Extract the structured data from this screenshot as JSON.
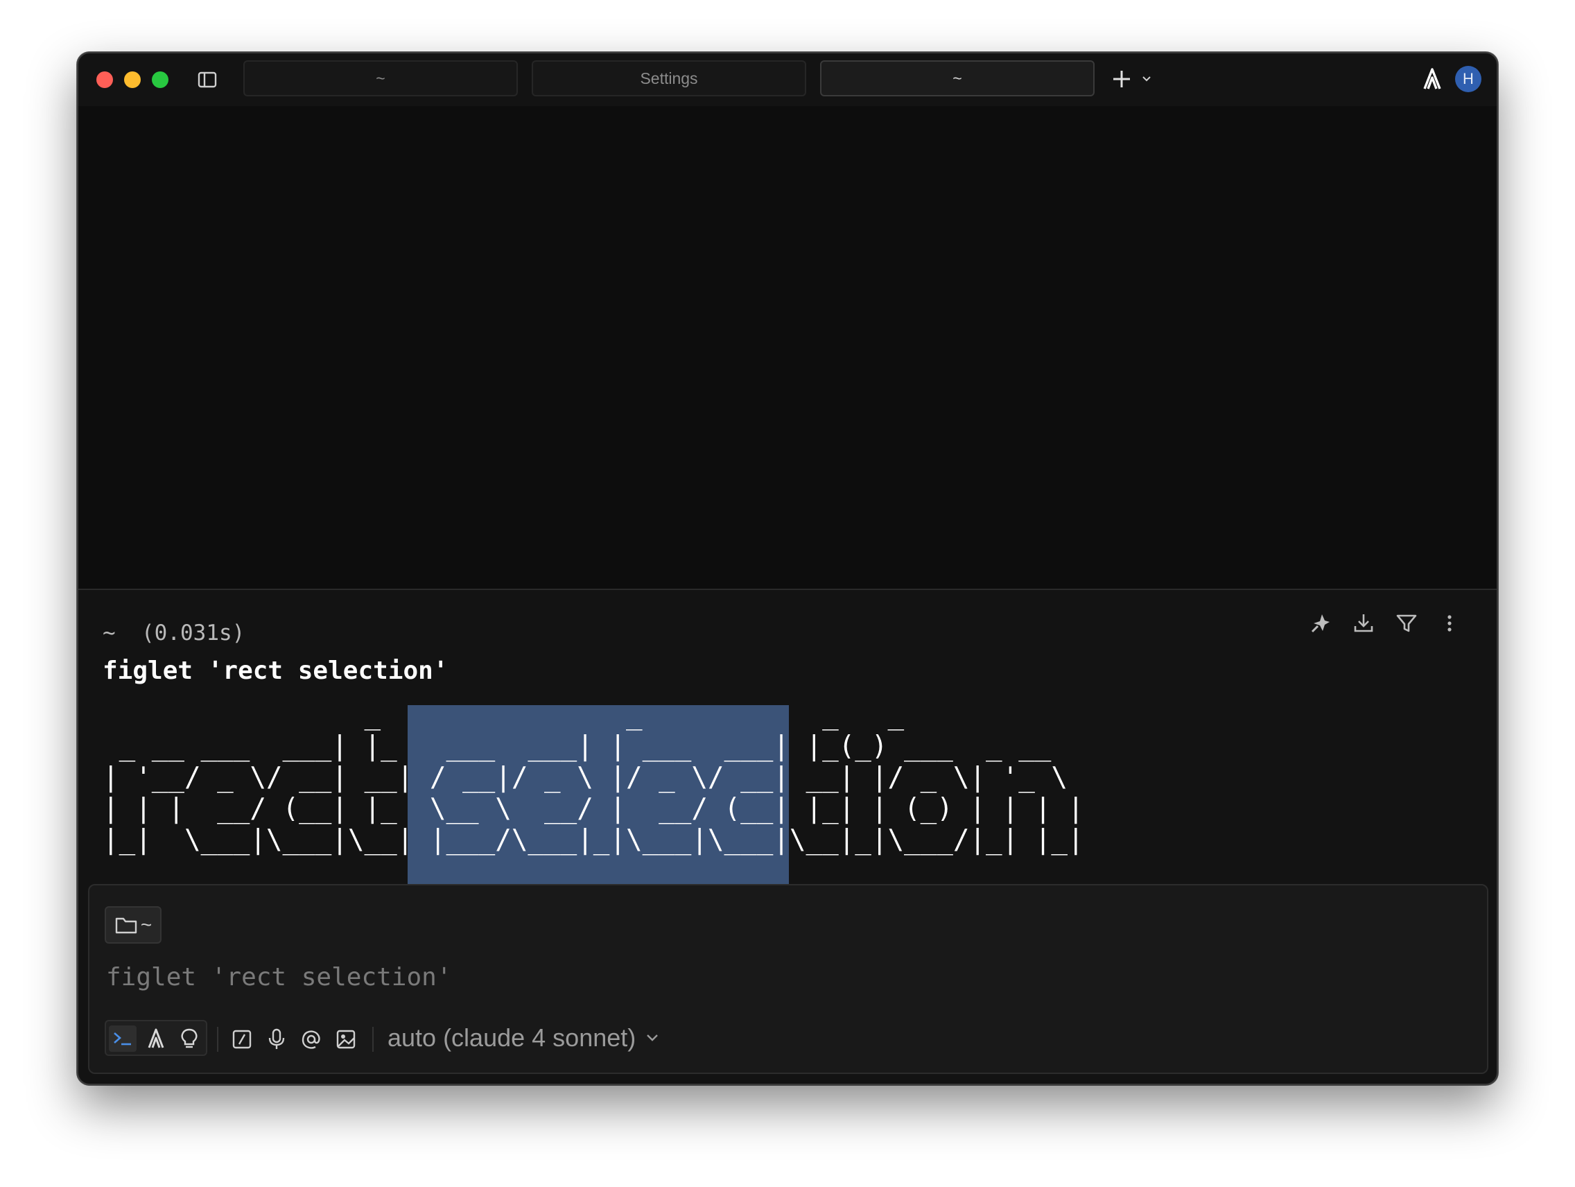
{
  "tabs": [
    {
      "label": "~",
      "active": false
    },
    {
      "label": "Settings",
      "active": false
    },
    {
      "label": "~",
      "active": true
    }
  ],
  "avatar": {
    "initial": "H",
    "color": "#2f5fb0"
  },
  "block": {
    "dir": "~",
    "duration": "(0.031s)",
    "command": "figlet 'rect selection'",
    "actions": [
      "sparkle-pin-icon",
      "download-icon",
      "filter-icon",
      "more-vertical-icon"
    ],
    "output_lines": [
      "                _               _           _   _",
      " _ __ ___  ___| |_   ___  ___| | ___  ___| |_(_) ___  _ __",
      "| '__/ _ \\/ __| __| / __|/ _ \\ |/ _ \\/ __| __| |/ _ \\| '_ \\",
      "| | |  __/ (__| |_  \\__ \\  __/ |  __/ (__| |_| | (_) | | | |",
      "|_|  \\___|\\___|\\__| |___/\\___|_|\\___|\\___|\\__|_|\\___/|_| |_|"
    ],
    "selection_color": "#3b5378"
  },
  "input": {
    "dir_chip": "~",
    "value": "figlet 'rect selection'",
    "model": "auto (claude 4 sonnet)",
    "mode_icons": [
      "terminal-prompt-icon",
      "agent-icon",
      "lightbulb-icon"
    ],
    "tool_icons": [
      "slash-command-icon",
      "microphone-icon",
      "at-mention-icon",
      "image-attach-icon"
    ]
  }
}
